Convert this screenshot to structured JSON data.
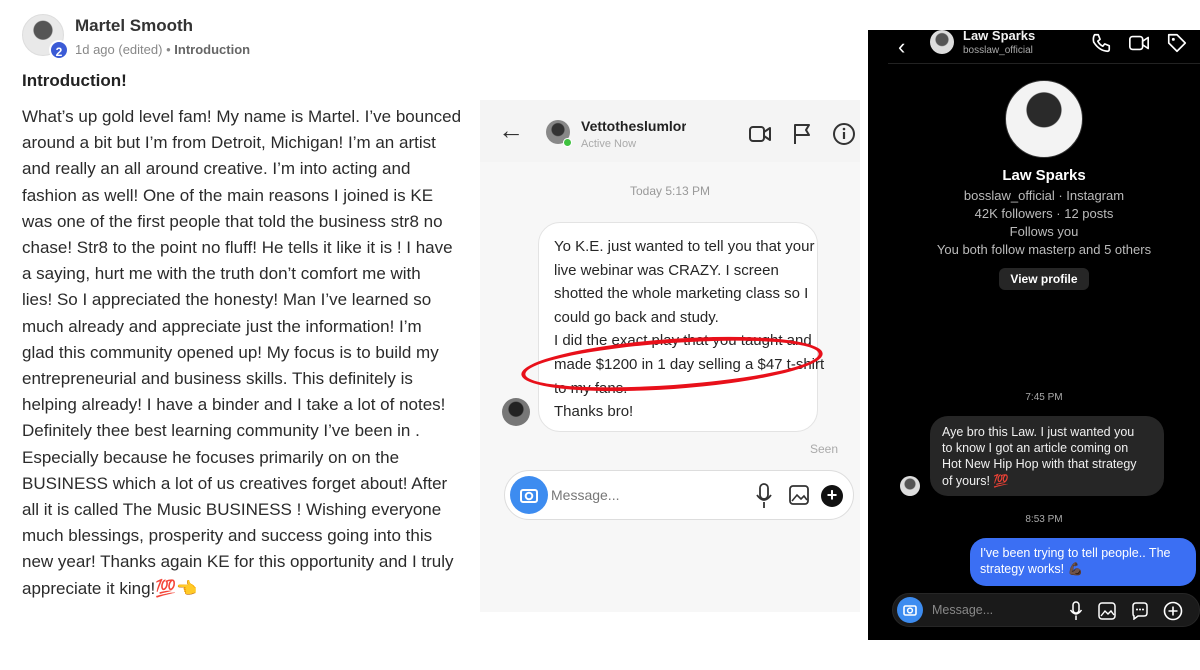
{
  "post": {
    "author": "Martel Smooth",
    "level_badge": "2",
    "time": "1d ago (edited)",
    "separator": "•",
    "category": "Introduction",
    "title": "Introduction!",
    "lines": [
      "What’s up gold level fam! My name is Martel. I’ve bounced",
      "around a bit but I’m from Detroit, Michigan! I’m an artist",
      "and really an all around creative. I’m into acting and",
      "fashion as well! One of the main reasons I joined is KE",
      "was one of the first people that told the business str8 no",
      "chase! Str8 to the point no fluff! He tells it like it is ! I have",
      "a saying, hurt me with the truth don’t comfort me with",
      "lies! So I appreciated the honesty! Man I’ve learned so",
      "much already and appreciate just the information! I’m",
      "glad this community opened up! My focus is to build my",
      "entrepreneurial and business skills. This definitely is",
      "helping already! I have a binder and I take a lot of notes!",
      "Definitely thee best learning community I’ve been in .",
      "Especially because he focuses primarily on on the",
      "BUSINESS which a lot of us creatives forget about! After",
      "all it is called The Music BUSINESS ! Wishing everyone",
      "much blessings, prosperity and success going into this",
      "new year! Thanks again KE for this opportunity and I truly",
      "appreciate it king!💯👈"
    ]
  },
  "dm_light": {
    "username": "Vettotheslumlorc",
    "status": "Active Now",
    "timestamp": "Today 5:13 PM",
    "message_lines": [
      "Yo K.E. just wanted to tell you that your",
      "live webinar was CRAZY. I screen",
      "shotted the whole marketing class so I",
      "could go back and study.",
      "I did the exact play that you taught and",
      "made $1200 in 1 day selling a $47 t-shirt",
      "to my fans.",
      "Thanks bro!"
    ],
    "seen": "Seen",
    "input_placeholder": "Message...",
    "icons": [
      "back-arrow-icon",
      "video-call-icon",
      "flag-icon",
      "info-icon",
      "camera-icon",
      "microphone-icon",
      "gallery-icon",
      "plus-icon"
    ],
    "highlight_color": "#e8101a"
  },
  "dm_dark": {
    "header_name": "Law Sparks",
    "header_handle": "bosslaw_official",
    "profile_name": "Law Sparks",
    "profile_lines": [
      "bosslaw_official · Instagram",
      "42K followers · 12 posts",
      "Follows you",
      "You both follow masterp and 5 others"
    ],
    "view_profile": "View profile",
    "time_1": "7:45 PM",
    "received_lines": [
      "Aye bro this Law. I just wanted you",
      "to know I got an article coming on",
      "Hot New Hip Hop with that strategy",
      "of yours! 💯"
    ],
    "time_2": "8:53 PM",
    "sent_lines": [
      "I've been trying to tell people.. The",
      "strategy works! 💪🏿"
    ],
    "input_placeholder": "Message...",
    "sent_color": "#3b6ff3",
    "icons": [
      "back-icon",
      "phone-icon",
      "video-icon",
      "tag-icon",
      "camera-icon",
      "microphone-icon",
      "gallery-icon",
      "sticker-icon",
      "plus-icon"
    ]
  }
}
